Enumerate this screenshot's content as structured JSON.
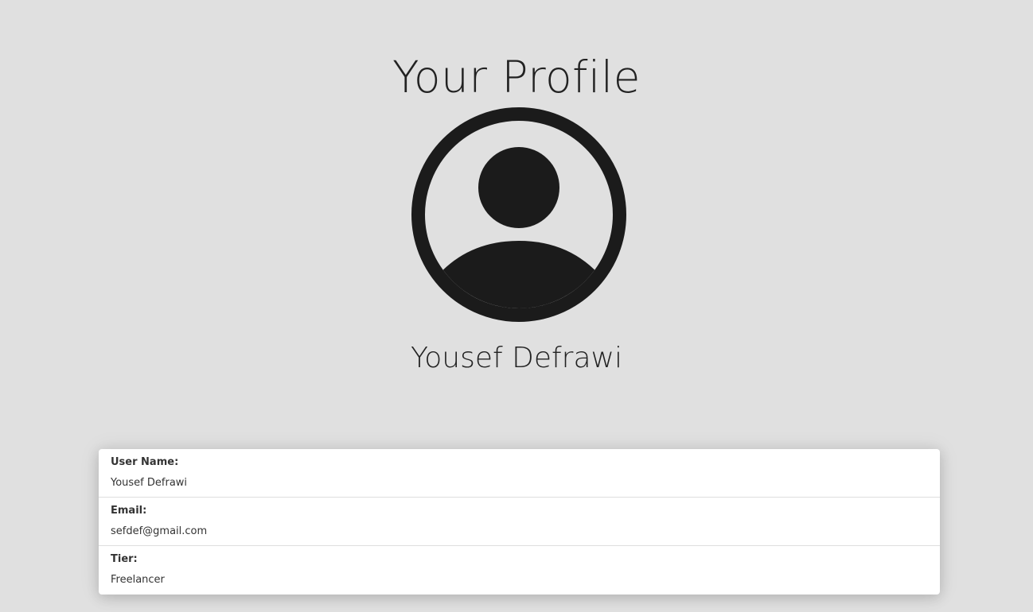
{
  "page": {
    "title": "Your Profile"
  },
  "avatar": {
    "icon": "user-circle-icon",
    "color": "#1b1b1b"
  },
  "user": {
    "display_name": "Yousef Defrawi"
  },
  "details": {
    "fields": [
      {
        "label": "User Name:",
        "value": "Yousef Defrawi"
      },
      {
        "label": "Email:",
        "value": "sefdef@gmail.com"
      },
      {
        "label": "Tier:",
        "value": "Freelancer"
      }
    ]
  },
  "colors": {
    "background": "#e0e0e0",
    "card": "#ffffff",
    "text": "#222222"
  }
}
